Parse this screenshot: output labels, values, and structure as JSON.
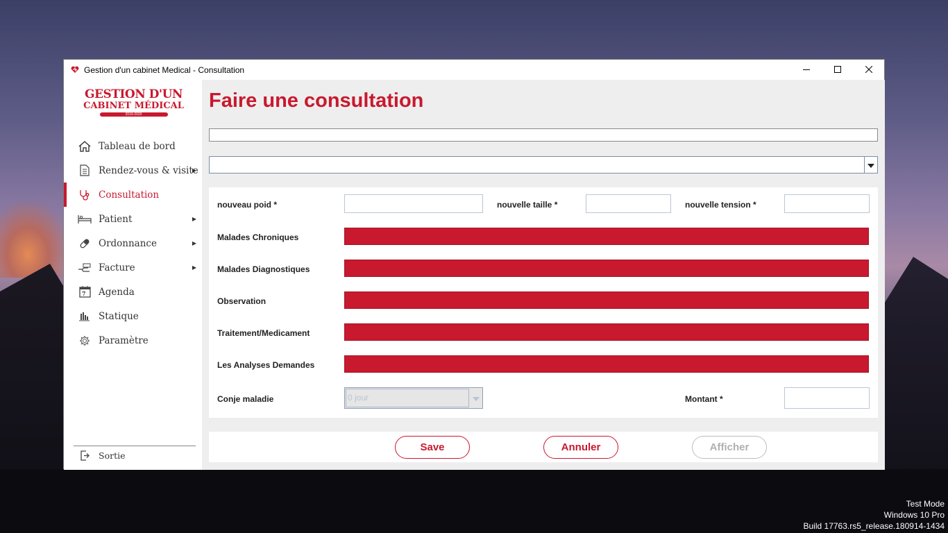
{
  "window": {
    "title": "Gestion d'un cabinet Medical - Consultation",
    "controls": {
      "minimize": "minimize-icon",
      "maximize": "maximize-icon",
      "close": "close-icon"
    }
  },
  "logo": {
    "line1": "GESTION D'UN",
    "line2": "CABINET MÉDICAL",
    "years": "2019-2020"
  },
  "sidebar": {
    "items": [
      {
        "label": "Tableau de bord",
        "icon": "home-icon",
        "arrow": false
      },
      {
        "label": "Rendez-vous & visite",
        "icon": "document-icon",
        "arrow": true
      },
      {
        "label": "Consultation",
        "icon": "stethoscope-icon",
        "arrow": false,
        "active": true
      },
      {
        "label": "Patient",
        "icon": "bed-icon",
        "arrow": true
      },
      {
        "label": "Ordonnance",
        "icon": "pill-icon",
        "arrow": true
      },
      {
        "label": "Facture",
        "icon": "hand-money-icon",
        "arrow": true
      },
      {
        "label": "Agenda",
        "icon": "calendar-icon",
        "arrow": false,
        "calendar_day": "7"
      },
      {
        "label": "Statique",
        "icon": "bar-chart-icon",
        "arrow": false
      },
      {
        "label": "Paramètre",
        "icon": "gear-icon",
        "arrow": false
      }
    ],
    "exit_label": "Sortie",
    "arrow_glyph": "▶"
  },
  "main": {
    "title": "Faire une consultation",
    "search_value": "",
    "combo_value": ""
  },
  "form": {
    "weight_label": "nouveau poid *",
    "weight_value": "",
    "height_label": "nouvelle taille *",
    "height_value": "",
    "tension_label": "nouvelle tension *",
    "tension_value": "",
    "chronic_label": "Malades Chroniques",
    "diagnostic_label": "Malades Diagnostiques",
    "observation_label": "Observation",
    "treatment_label": "Traitement/Medicament",
    "analyses_label": "Les Analyses Demandes",
    "sick_leave_label": "Conje maladie",
    "sick_leave_value": "0  jour",
    "amount_label": "Montant *",
    "amount_value": ""
  },
  "buttons": {
    "save": "Save",
    "cancel": "Annuler",
    "show": "Afficher",
    "show_enabled": false
  },
  "colors": {
    "accent": "#c8192e",
    "panel_bg": "#eeeeee"
  },
  "os_watermark": {
    "line1": "Test Mode",
    "line2": "Windows 10 Pro",
    "line3": "Build 17763.rs5_release.180914-1434"
  }
}
